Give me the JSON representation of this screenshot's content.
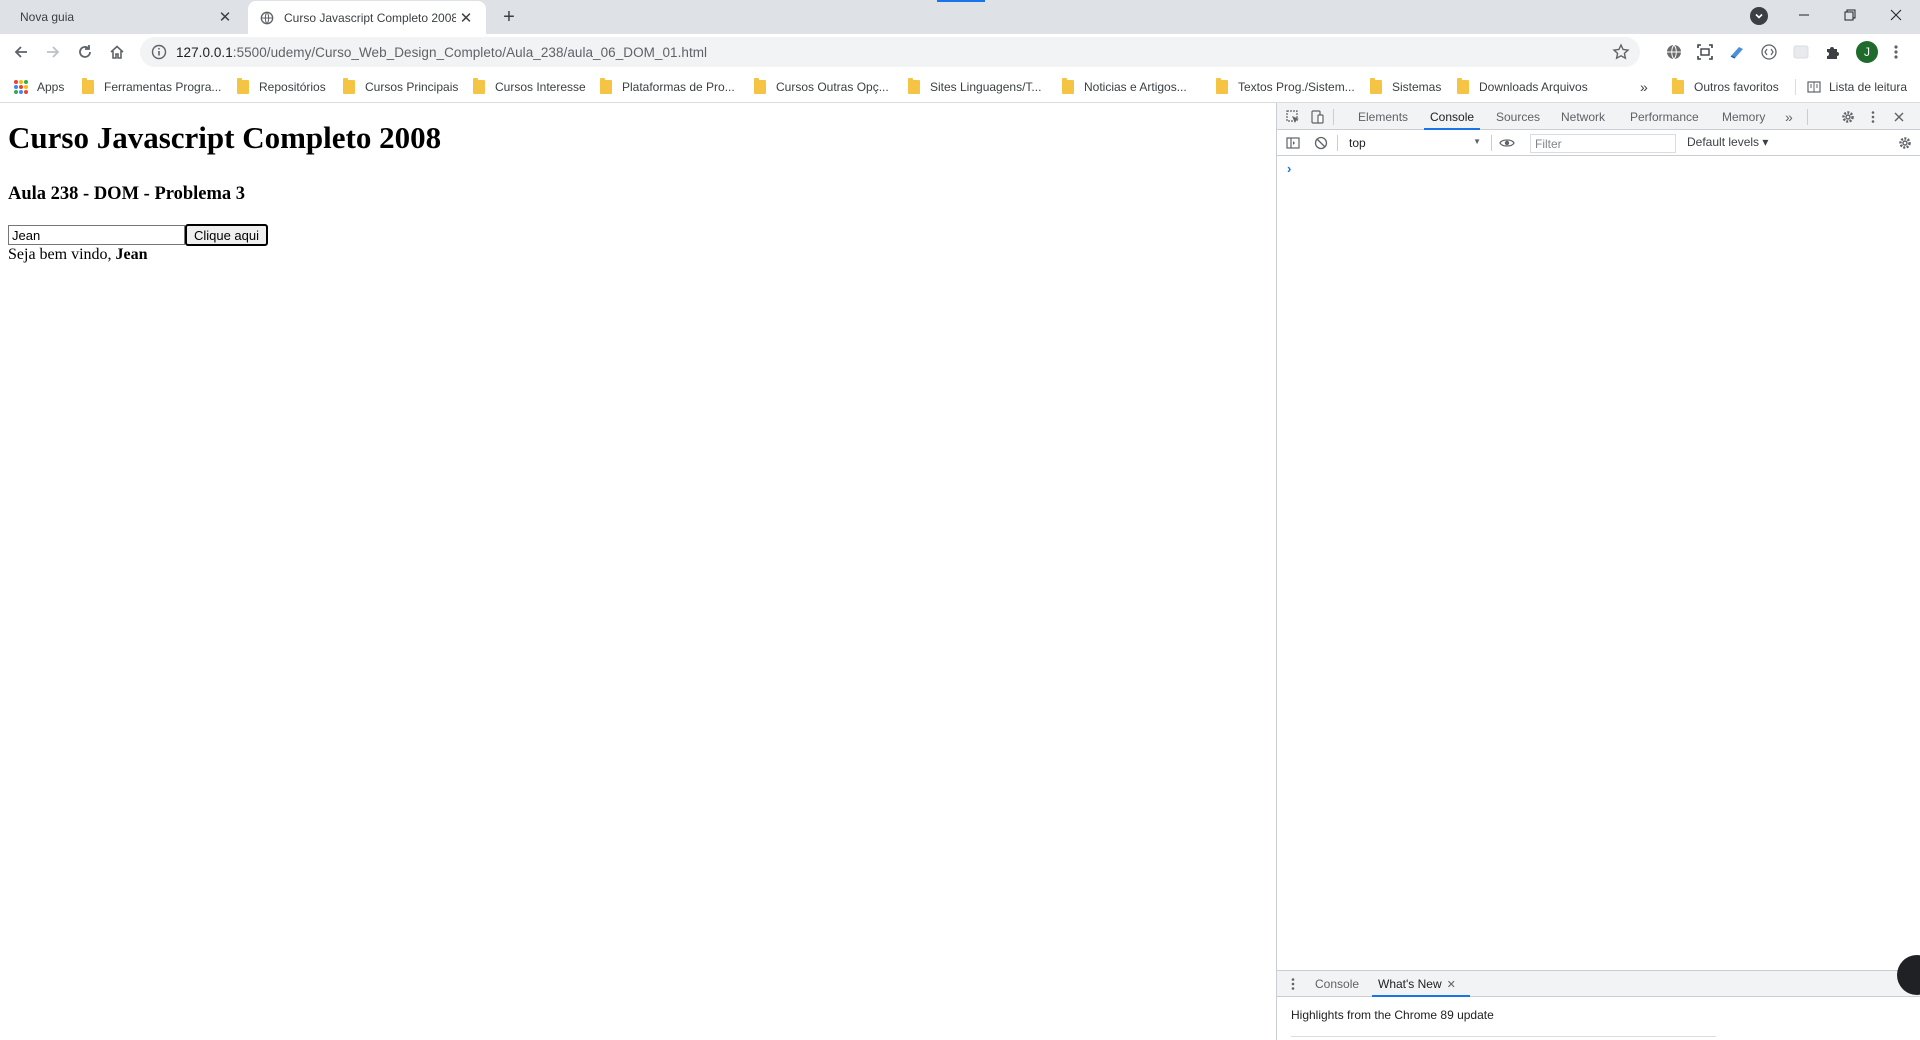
{
  "browser": {
    "tabs": [
      {
        "title": "Nova guia",
        "active": false
      },
      {
        "title": "Curso Javascript Completo 2008",
        "active": true
      }
    ],
    "url_host": "127.0.0.1",
    "url_path": ":5500/udemy/Curso_Web_Design_Completo/Aula_238/aula_06_DOM_01.html",
    "profile_initial": "J",
    "bookmarks": {
      "apps": "Apps",
      "items": [
        "Ferramentas Progra...",
        "Repositórios",
        "Cursos Principais",
        "Cursos Interesse",
        "Plataformas de Pro...",
        "Cursos Outras Opç...",
        "Sites Linguagens/T...",
        "Noticias e Artigos...",
        "Textos Prog./Sistem...",
        "Sistemas",
        "Downloads Arquivos"
      ],
      "overflow": "»",
      "other": "Outros favoritos",
      "reading_list": "Lista de leitura"
    }
  },
  "page": {
    "title": "Curso Javascript Completo 2008",
    "subtitle": "Aula 238 - DOM - Problema 3",
    "input_value": "Jean",
    "button_label": "Clique aqui",
    "welcome_prefix": "Seja bem vindo, ",
    "welcome_name": "Jean"
  },
  "devtools": {
    "tabs": [
      "Elements",
      "Console",
      "Sources",
      "Network",
      "Performance",
      "Memory"
    ],
    "active_tab": "Console",
    "more": "»",
    "context": "top",
    "filter_placeholder": "Filter",
    "levels": "Default levels ▾",
    "prompt": "›",
    "drawer_tabs": [
      "Console",
      "What's New"
    ],
    "drawer_active": "What's New",
    "drawer_text": "Highlights from the Chrome 89 update"
  },
  "colors": {
    "accent": "#1a73e8",
    "folder": "#f6c444",
    "avatar": "#1e6b2b"
  }
}
